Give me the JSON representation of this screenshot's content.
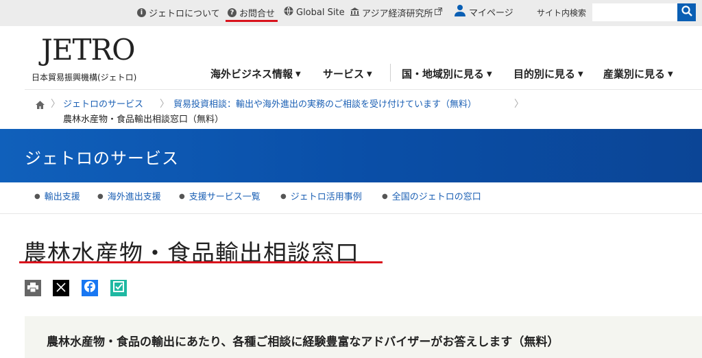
{
  "top_links": {
    "about": "ジェトロについて",
    "contact": "お問合せ",
    "global": "Global Site",
    "ide": "アジア経済研究所",
    "mypage": "マイページ"
  },
  "search": {
    "label": "サイト内検索",
    "placeholder": ""
  },
  "logo": {
    "main": "JETRO",
    "sub": "日本貿易振興機構(ジェトロ)"
  },
  "nav": [
    "海外ビジネス情報",
    "サービス",
    "国・地域別に見る",
    "目的別に見る",
    "産業別に見る"
  ],
  "breadcrumb": [
    "ジェトロのサービス",
    "貿易投資相談：輸出や海外進出の実務のご相談を受け付けています（無料）",
    "農林水産物・食品輸出相談窓口（無料）"
  ],
  "hero": {
    "title": "ジェトロのサービス"
  },
  "subnav": [
    "輸出支援",
    "海外進出支援",
    "支援サービス一覧",
    "ジェトロ活用事例",
    "全国のジェトロの窓口"
  ],
  "page": {
    "title": "農林水産物・食品輸出相談窓口",
    "lead": "農林水産物・食品の輸出にあたり、各種ご相談に経験豊富なアドバイザーがお答えします（無料）"
  },
  "colors": {
    "accent_red": "#d9121c",
    "brand_blue": "#0a5fb4",
    "link": "#1a5fb4"
  }
}
